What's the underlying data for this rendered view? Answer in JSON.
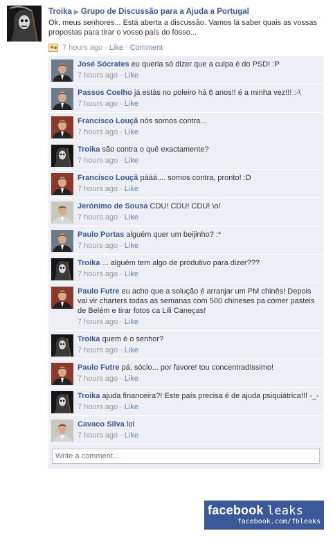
{
  "post": {
    "author": "Troika",
    "group": "Grupo de Discussão para a Ajuda a Portugal",
    "text": "Ok, meus senhores... Está aberta a discussão. Vamos lá saber quais as vossas propostas para tirar o vosso país do fosso...",
    "time": "7 hours ago",
    "like": "Like",
    "comment": "Comment"
  },
  "comments": [
    {
      "name": "José Sócrates",
      "text": "eu queria só dizer que a culpa é do PSD! :P",
      "time": "7 hours ago",
      "like": "Like",
      "avatar": "suit-man"
    },
    {
      "name": "Passos Coelho",
      "text": "já estás no poleiro há 6 anos!! é a minha vez!!! :-\\",
      "time": "7 hours ago",
      "like": "Like",
      "avatar": "suit-man"
    },
    {
      "name": "Francisco Louçã",
      "text": "nós somos contra...",
      "time": "7 hours ago",
      "like": "Like",
      "avatar": "man-red"
    },
    {
      "name": "Troika",
      "text": "são contra o quê exactamente?",
      "time": "7 hours ago",
      "like": "Like",
      "avatar": "reaper"
    },
    {
      "name": "Francisco Louçã",
      "text": "pááá.... somos contra, pronto! :D",
      "time": "7 hours ago",
      "like": "Like",
      "avatar": "man-red"
    },
    {
      "name": "Jerónimo de Sousa",
      "text": "CDU! CDU! CDU! \\o/",
      "time": "7 hours ago",
      "like": "Like",
      "avatar": "man-light"
    },
    {
      "name": "Paulo Portas",
      "text": "alguém quer um beijinho? :*",
      "time": "7 hours ago",
      "like": "Like",
      "avatar": "suit-man"
    },
    {
      "name": "Troika",
      "text": "... alguém tem algo de produtivo para dizer???",
      "time": "7 hours ago",
      "like": "Like",
      "avatar": "reaper"
    },
    {
      "name": "Paulo Futre",
      "text": "eu acho que a solução é arranjar um PM chinês! Depois vai vir charters  todas as semanas com 500 chineses pa comer pasteis de Belém e tirar fotos ca Lili Caneças!",
      "time": "7 hours ago",
      "like": "Like",
      "avatar": "man-red"
    },
    {
      "name": "Troika",
      "text": "quem é o senhor?",
      "time": "7 hours ago",
      "like": "Like",
      "avatar": "reaper"
    },
    {
      "name": "Paulo Futre",
      "text": "pá, sócio... por favore! tou concentradíssimo!",
      "time": "7 hours ago",
      "like": "Like",
      "avatar": "man-red"
    },
    {
      "name": "Troika",
      "text": "ajuda financeira?! Este país precisa é de ajuda psiquiátrica!!! -_-",
      "time": "7 hours ago",
      "like": "Like",
      "avatar": "reaper"
    },
    {
      "name": "Cavaco Silva",
      "text": "lol",
      "time": "7 hours ago",
      "like": "Like",
      "avatar": "man-light"
    }
  ],
  "write_comment_placeholder": "Write a comment...",
  "badge": {
    "title": "facebook",
    "leaks": "leaks",
    "url": "facebook.com/fbleaks"
  }
}
